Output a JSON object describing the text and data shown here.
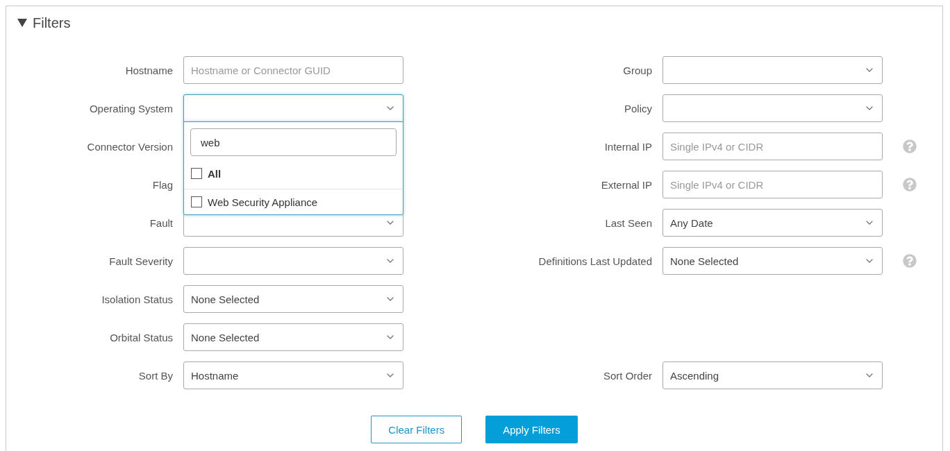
{
  "panel": {
    "title": "Filters",
    "expanded": true
  },
  "rows": [
    {
      "left": {
        "label": "Hostname",
        "field": {
          "kind": "input",
          "placeholder": "Hostname or Connector GUID"
        }
      },
      "right": {
        "label": "Group",
        "field": {
          "kind": "select"
        }
      }
    },
    {
      "left": {
        "label": "Operating System",
        "field": {
          "kind": "select",
          "open": true,
          "dropdown": {
            "search": "web",
            "options": [
              {
                "kind": "all",
                "label": "All",
                "checked": false
              },
              {
                "kind": "option",
                "label": "Web Security Appliance",
                "checked": false
              }
            ]
          }
        }
      },
      "right": {
        "label": "Policy",
        "field": {
          "kind": "select"
        }
      }
    },
    {
      "left": {
        "label": "Connector Version"
      },
      "right": {
        "label": "Internal IP",
        "field": {
          "kind": "input",
          "placeholder": "Single IPv4 or CIDR"
        },
        "help": true
      }
    },
    {
      "left": {
        "label": "Flag"
      },
      "right": {
        "label": "External IP",
        "field": {
          "kind": "input",
          "placeholder": "Single IPv4 or CIDR"
        },
        "help": true
      }
    },
    {
      "left": {
        "label": "Fault",
        "field": {
          "kind": "select"
        }
      },
      "right": {
        "label": "Last Seen",
        "field": {
          "kind": "select",
          "value": "Any Date"
        }
      }
    },
    {
      "left": {
        "label": "Fault Severity",
        "field": {
          "kind": "select"
        }
      },
      "right": {
        "label": "Definitions Last Updated",
        "field": {
          "kind": "select",
          "value": "None Selected"
        },
        "help": true
      }
    },
    {
      "left": {
        "label": "Isolation Status",
        "field": {
          "kind": "select",
          "value": "None Selected"
        }
      }
    },
    {
      "left": {
        "label": "Orbital Status",
        "field": {
          "kind": "select",
          "value": "None Selected"
        }
      }
    },
    {
      "left": {
        "label": "Sort By",
        "field": {
          "kind": "select",
          "value": "Hostname"
        }
      },
      "right": {
        "label": "Sort Order",
        "field": {
          "kind": "select",
          "value": "Ascending"
        }
      }
    }
  ],
  "buttons": [
    {
      "kind": "secondary",
      "label": "Clear Filters"
    },
    {
      "kind": "primary",
      "label": "Apply Filters"
    }
  ]
}
